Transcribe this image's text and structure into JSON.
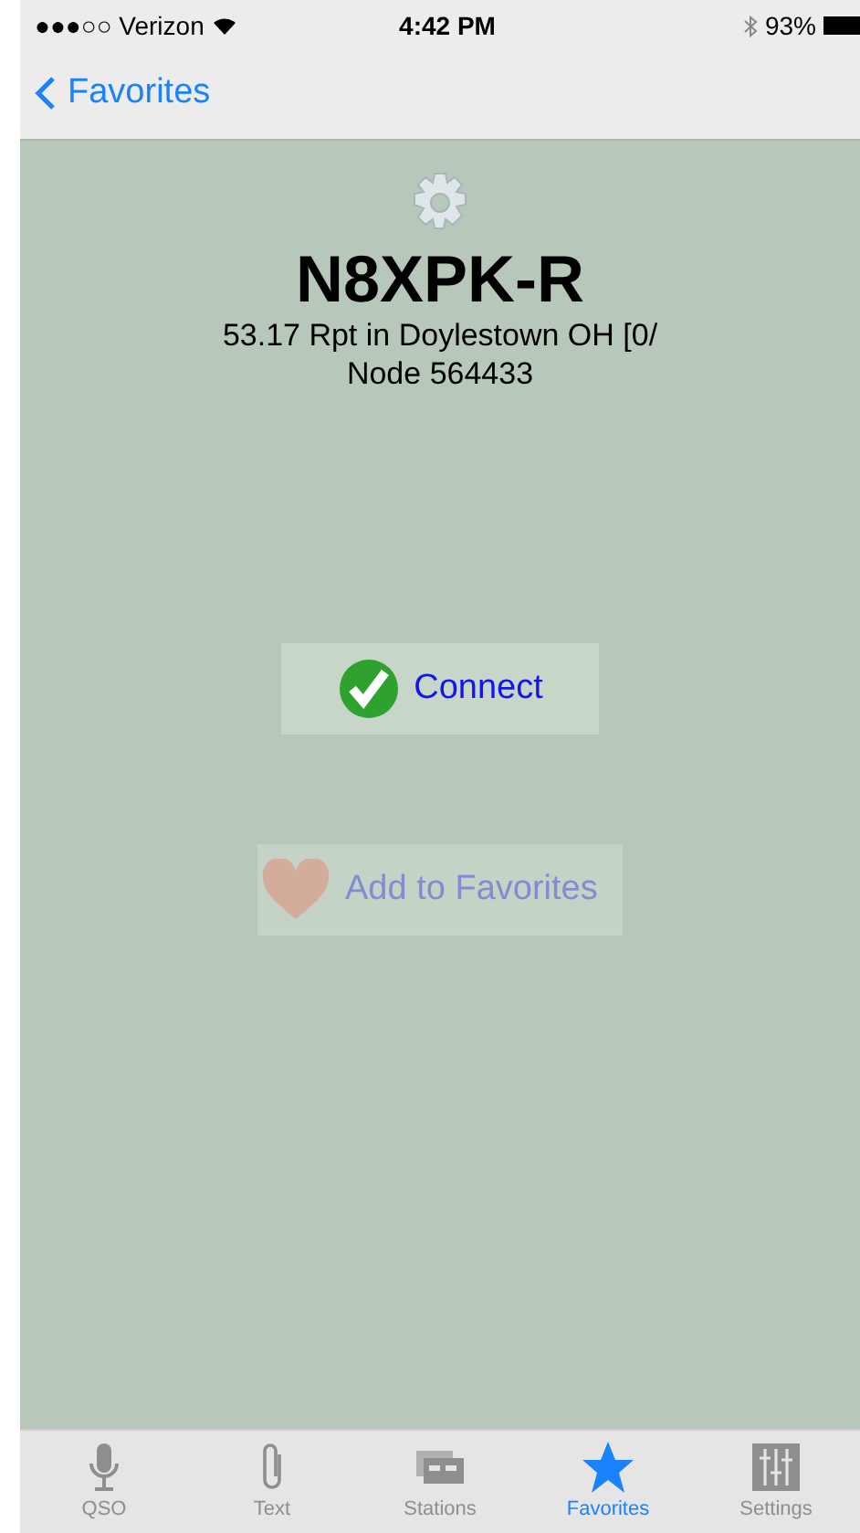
{
  "status_bar": {
    "carrier": "●●●○○ Verizon",
    "time": "4:42 PM",
    "battery": "93%"
  },
  "nav": {
    "back": "Favorites"
  },
  "station": {
    "callsign": "N8XPK-R",
    "description": "53.17 Rpt in Doylestown OH [0/",
    "node": "Node 564433"
  },
  "actions": [
    {
      "kind": "connect",
      "label": "Connect",
      "disabled": false
    },
    {
      "kind": "favorite",
      "label": "Add to Favorites",
      "disabled": true
    }
  ],
  "tabs": [
    {
      "kind": "mic",
      "label": "QSO",
      "selected": false
    },
    {
      "kind": "clip",
      "label": "Text",
      "selected": false
    },
    {
      "kind": "stations",
      "label": "Stations",
      "selected": false
    },
    {
      "kind": "star",
      "label": "Favorites",
      "selected": true
    },
    {
      "kind": "sliders",
      "label": "Settings",
      "selected": false
    }
  ]
}
